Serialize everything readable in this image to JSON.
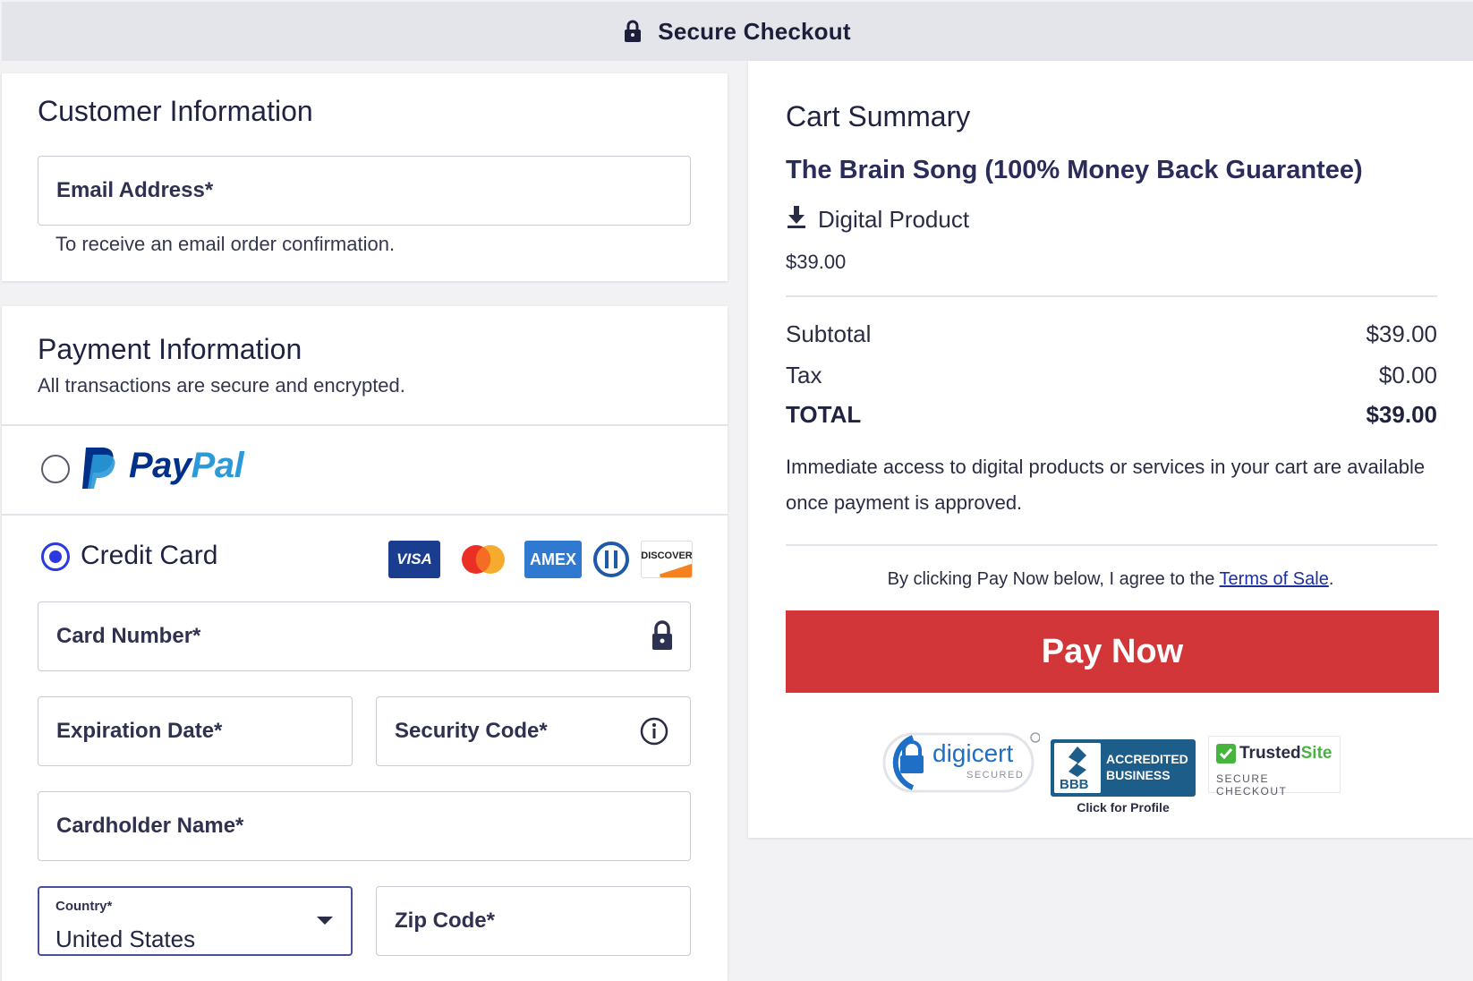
{
  "header": {
    "title": "Secure Checkout",
    "icon": "lock-icon"
  },
  "customer": {
    "heading": "Customer Information",
    "email_placeholder": "Email Address*",
    "email_help": "To receive an email order confirmation."
  },
  "payment": {
    "heading": "Payment Information",
    "subheading": "All transactions are secure and encrypted.",
    "paypal": {
      "word_1": "Pay",
      "word_2": "Pal",
      "selected": false
    },
    "credit_card": {
      "label": "Credit Card",
      "selected": true
    },
    "card_brands": [
      "VISA",
      "Mastercard",
      "AMEX",
      "Diners Club",
      "DISCOVER"
    ],
    "card_number_placeholder": "Card Number*",
    "expiration_placeholder": "Expiration Date*",
    "security_code_placeholder": "Security Code*",
    "cardholder_placeholder": "Cardholder Name*",
    "country": {
      "label": "Country*",
      "value": "United States"
    },
    "zip_placeholder": "Zip Code*"
  },
  "cart": {
    "heading": "Cart Summary",
    "product_title": "The Brain Song (100% Money Back Guarantee)",
    "product_type": "Digital Product",
    "product_price": "$39.00",
    "subtotal_label": "Subtotal",
    "subtotal_value": "$39.00",
    "tax_label": "Tax",
    "tax_value": "$0.00",
    "total_label": "TOTAL",
    "total_value": "$39.00",
    "access_note": "Immediate access to digital products or services in your cart are available once payment is approved.",
    "agree_text": "By clicking Pay Now below, I agree to the ",
    "terms_link": "Terms of Sale",
    "agree_end": ".",
    "pay_button": "Pay Now"
  },
  "badges": {
    "digicert": {
      "name": "digicert",
      "sub": "SECURED"
    },
    "bbb": {
      "line1": "ACCREDITED",
      "line2": "BUSINESS",
      "logo": "BBB",
      "caption": "Click for Profile"
    },
    "trustedsite": {
      "word_1": "Trusted",
      "word_2": "Site",
      "sub": "SECURE CHECKOUT"
    }
  },
  "colors": {
    "primary": "#2a3ae0",
    "pay_button": "#d33638",
    "paypal_dark": "#003087",
    "paypal_light": "#2a9ad8"
  }
}
